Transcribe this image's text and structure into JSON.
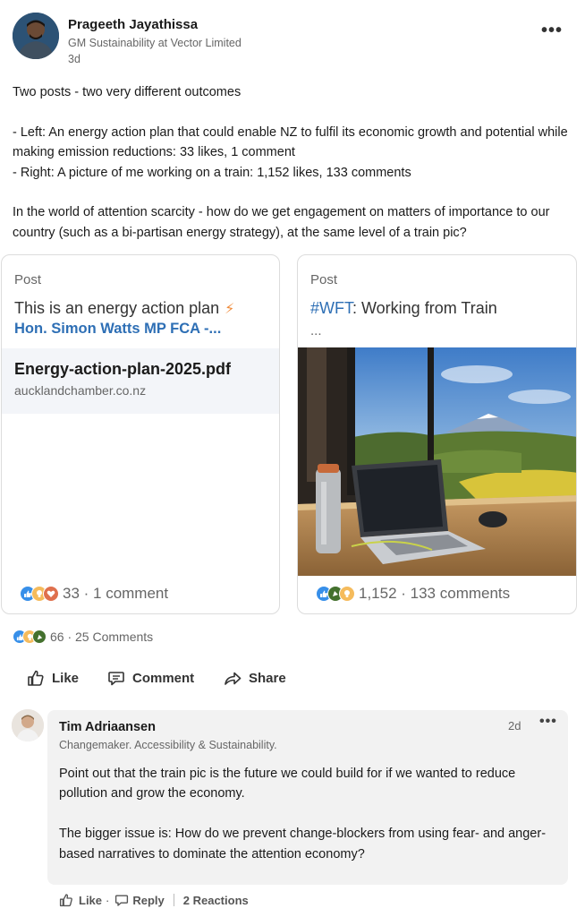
{
  "author": {
    "name": "Prageeth Jayathissa",
    "title": "GM Sustainability at Vector Limited",
    "time": "3d"
  },
  "post": {
    "paragraphs": [
      [
        "Two posts - two very different outcomes"
      ],
      [
        "- Left: An energy action plan that could enable NZ to fulfil its economic growth and potential while making emission reductions: 33 likes, 1 comment",
        "- Right: A picture of me working on a train: 1,152 likes, 133 comments"
      ],
      [
        "In the world of attention scarcity - how do we get engagement on matters of importance to our country (such as a bi-partisan energy strategy), at the same level of a train pic?"
      ]
    ]
  },
  "cards": {
    "left": {
      "kind": "Post",
      "line1": "This is an energy action plan",
      "line2": "Hon. Simon Watts MP FCA -...",
      "doc_name": "Energy-action-plan-2025.pdf",
      "doc_domain": "aucklandchamber.co.nz",
      "stats": "33 · 1 comment"
    },
    "right": {
      "kind": "Post",
      "hashtag": "#WFT",
      "line1_rest": ": Working from Train",
      "ellipsis": "...",
      "stats": "1,152 · 133 comments"
    }
  },
  "summary": {
    "text": "66 · 25 Comments"
  },
  "actions": {
    "like": "Like",
    "comment": "Comment",
    "share": "Share"
  },
  "comment": {
    "name": "Tim Adriaansen",
    "headline": "Changemaker. Accessibility & Sustainability.",
    "time": "2d",
    "paragraphs": [
      "Point out that the train pic is the future we could build for if we wanted to reduce pollution and grow the economy.",
      "The bigger issue is: How do we prevent change-blockers from using fear- and anger-based narratives to dominate the attention economy?"
    ],
    "like": "Like",
    "reply": "Reply",
    "reactions": "2 Reactions"
  },
  "colors": {
    "link": "#2e6fb5",
    "like_blue": "#378fe9",
    "celebrate_green": "#44712e",
    "support_purple": "#715e86",
    "love_red": "#df704d",
    "insightful_yellow": "#f5bb5c"
  }
}
